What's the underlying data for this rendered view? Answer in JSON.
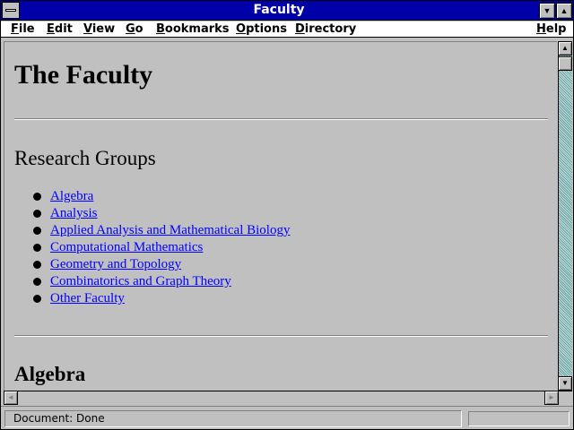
{
  "window": {
    "title": "Faculty"
  },
  "menu": {
    "file": "File",
    "edit": "Edit",
    "view": "View",
    "go": "Go",
    "bookmarks": "Bookmarks",
    "options": "Options",
    "directory": "Directory",
    "help": "Help"
  },
  "page": {
    "title": "The Faculty",
    "section_heading": "Research Groups",
    "links": [
      "Algebra",
      "Analysis",
      "Applied Analysis and Mathematical Biology",
      "Computational Mathematics",
      "Geometry and Topology",
      "Combinatorics and Graph Theory",
      "Other Faculty"
    ],
    "next_heading": "Algebra"
  },
  "status": {
    "text": "Document: Done"
  },
  "icons": {
    "system_menu": "system-menu-icon",
    "minimize": "minimize-icon",
    "maximize": "maximize-icon",
    "scroll_up": "arrow-up-icon",
    "scroll_down": "arrow-down-icon",
    "scroll_left": "arrow-left-icon",
    "scroll_right": "arrow-right-icon"
  },
  "colors": {
    "title_bar": "#0000a8",
    "link": "#0000ff",
    "background": "#c0c0c0"
  }
}
